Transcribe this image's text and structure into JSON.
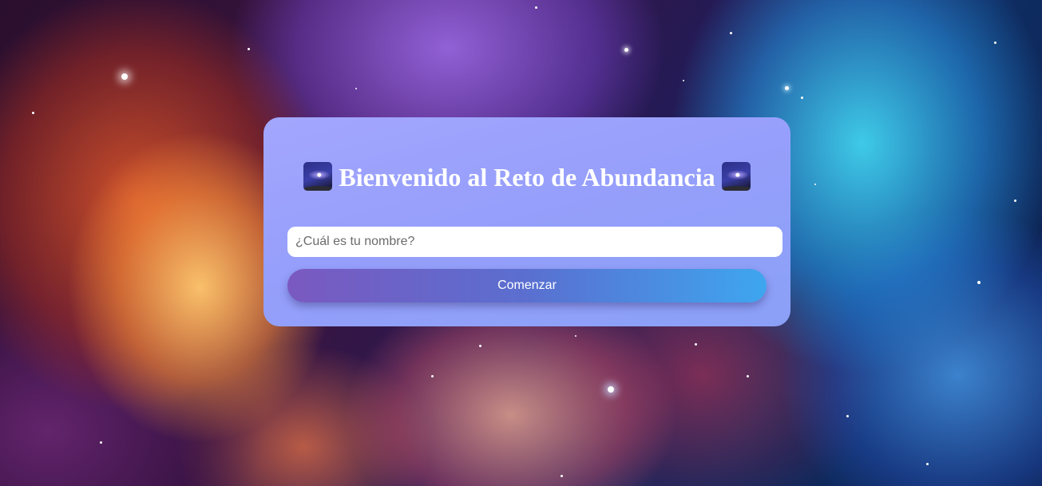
{
  "welcome": {
    "title": "Bienvenido al Reto de Abundancia",
    "title_icon": "milky-way-emoji",
    "input_placeholder": "¿Cuál es tu nombre?",
    "input_value": "",
    "start_button_label": "Comenzar"
  },
  "colors": {
    "card_background": "#969ffb",
    "button_gradient_start": "#7a59c0",
    "button_gradient_end": "#3ea6ef",
    "title_text": "#ffffff"
  }
}
